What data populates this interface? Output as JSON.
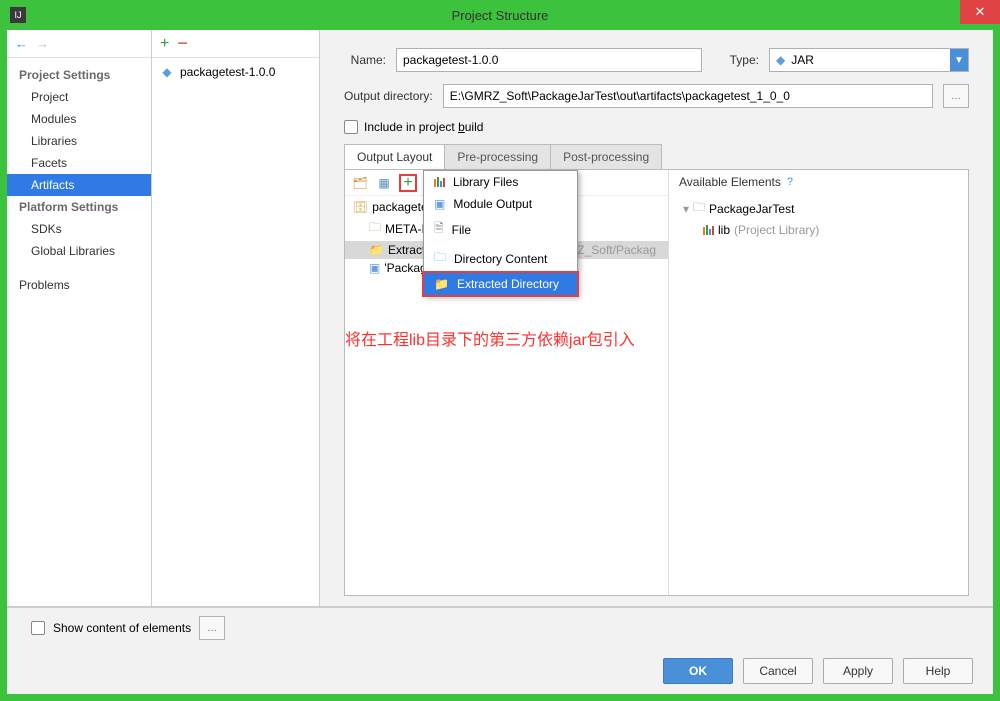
{
  "window": {
    "title": "Project Structure"
  },
  "leftNav": {
    "projectSettings": "Project Settings",
    "items1": [
      "Project",
      "Modules",
      "Libraries",
      "Facets",
      "Artifacts"
    ],
    "platformSettings": "Platform Settings",
    "items2": [
      "SDKs",
      "Global Libraries"
    ],
    "problems": "Problems"
  },
  "artifact": {
    "name": "packagetest-1.0.0"
  },
  "form": {
    "nameLabel": "Name:",
    "nameValue": "packagetest-1.0.0",
    "typeLabel": "Type:",
    "typeValue": "JAR",
    "outdirLabel": "Output directory:",
    "outdirValue": "E:\\GMRZ_Soft\\PackageJarTest\\out\\artifacts\\packagetest_1_0_0",
    "includeLabel": "Include in project build"
  },
  "tabs": {
    "t1": "Output Layout",
    "t2": "Pre-processing",
    "t3": "Post-processing"
  },
  "tree": {
    "root": "packagetest-",
    "meta": "META-INF",
    "extracted": "Extracted",
    "packagej": "'PackageJ",
    "pathHint": "/GMRZ_Soft/Packag"
  },
  "menu": {
    "m1": "Library Files",
    "m2": "Module Output",
    "m3": "File",
    "m4": "Directory Content",
    "m5": "Extracted Directory"
  },
  "available": {
    "header": "Available Elements",
    "proj": "PackageJarTest",
    "lib": "lib",
    "libNote": "(Project Library)"
  },
  "annotation": "将在工程lib目录下的第三方依赖jar包引入",
  "bottom": {
    "showContent": "Show content of elements"
  },
  "buttons": {
    "ok": "OK",
    "cancel": "Cancel",
    "apply": "Apply",
    "help": "Help"
  }
}
